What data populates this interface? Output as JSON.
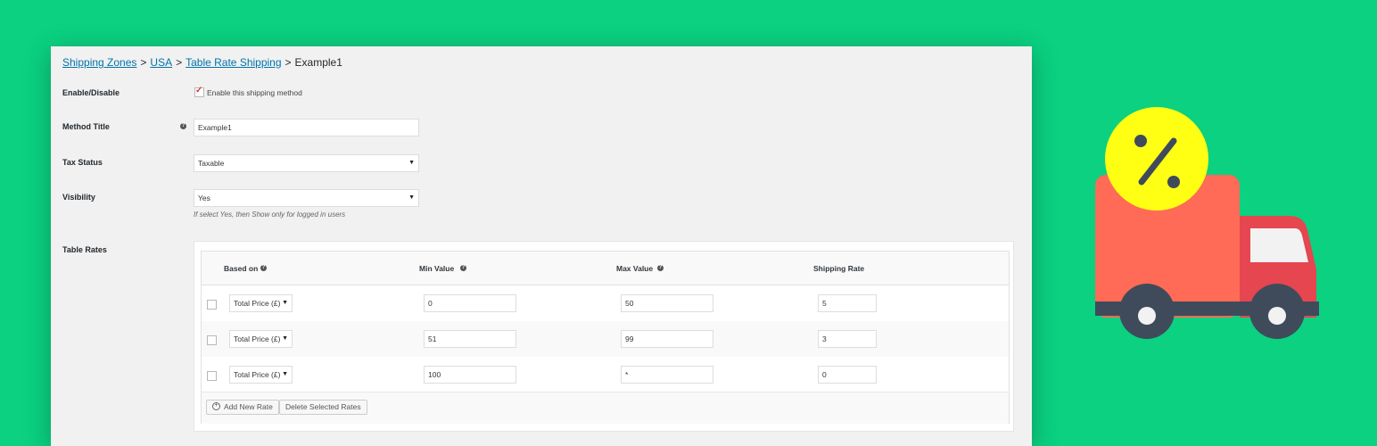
{
  "breadcrumb": {
    "links": [
      "Shipping Zones",
      "USA",
      "Table Rate Shipping"
    ],
    "current": "Example1",
    "separator": ">"
  },
  "form": {
    "enable": {
      "label": "Enable/Disable",
      "checkbox_label": "Enable this shipping method",
      "checked": true
    },
    "method_title": {
      "label": "Method Title",
      "value": "Example1"
    },
    "tax_status": {
      "label": "Tax Status",
      "value": "Taxable"
    },
    "visibility": {
      "label": "Visibility",
      "value": "Yes",
      "description": "If select Yes, then Show only for logged in users"
    },
    "table_rates_label": "Table Rates"
  },
  "rates": {
    "headers": {
      "based_on": "Based on",
      "min_value": "Min Value",
      "max_value": "Max Value",
      "shipping_rate": "Shipping Rate"
    },
    "rows": [
      {
        "based_on": "Total Price (£)",
        "min": "0",
        "max": "50",
        "rate": "5"
      },
      {
        "based_on": "Total Price (£)",
        "min": "51",
        "max": "99",
        "rate": "3"
      },
      {
        "based_on": "Total Price (£)",
        "min": "100",
        "max": "*",
        "rate": "0"
      }
    ],
    "add_button": "Add New Rate",
    "delete_button": "Delete Selected Rates"
  },
  "icons": {
    "help": "question-circle-icon",
    "dropdown": "caret-down-icon",
    "add": "plus-circle-icon",
    "illustration": "delivery-truck-icon",
    "badge": "percent-icon"
  },
  "colors": {
    "background": "#0bd181",
    "link": "#0073aa",
    "truck_body": "#ff6b56",
    "truck_cab": "#e5464f",
    "badge": "#ffff14",
    "wheel": "#3f4b5b"
  }
}
